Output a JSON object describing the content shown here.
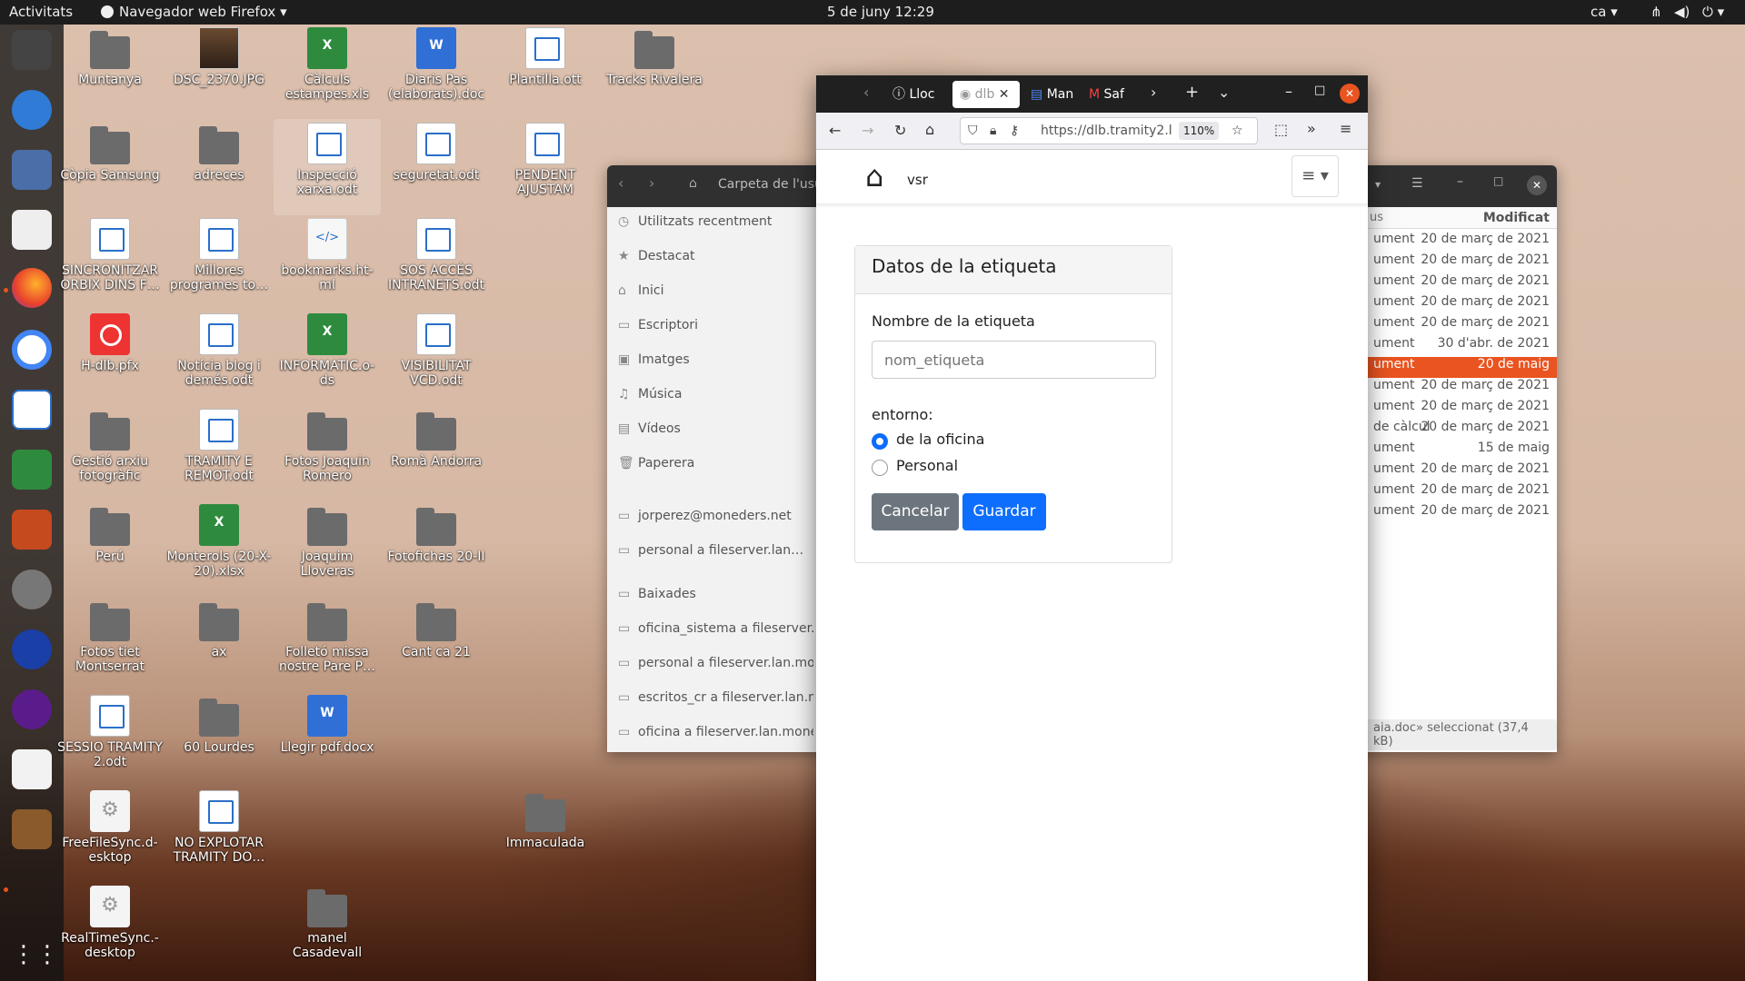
{
  "topbar": {
    "activities": "Activitats",
    "app": "Navegador web Firefox ▾",
    "clock": "5 de juny  12:29",
    "lang": "ca ▾"
  },
  "desktop": {
    "icons": [
      {
        "label": "Muntanya",
        "type": "folder"
      },
      {
        "label": "DSC_2370.JPG",
        "type": "photo"
      },
      {
        "label": "Càlculs estampes.xls",
        "type": "sheet"
      },
      {
        "label": "Diaris Pas (elaborats).doc",
        "type": "word"
      },
      {
        "label": "Plantilla.ott",
        "type": "doc"
      },
      {
        "label": "Tracks Rivalera",
        "type": "folder"
      },
      {
        "label": "Còpia Samsung",
        "type": "folder"
      },
      {
        "label": "adreces",
        "type": "folder"
      },
      {
        "label": "Inspecció xarxa.odt",
        "type": "doc"
      },
      {
        "label": "seguretat.odt",
        "type": "doc"
      },
      {
        "label": "PENDENT AJUSTAM",
        "type": "doc"
      },
      {
        "label": "SINCRONITZAR ORBIX DINS F…",
        "type": "doc"
      },
      {
        "label": "Millores programes to…",
        "type": "doc"
      },
      {
        "label": "bookmarks.ht-ml",
        "type": "code"
      },
      {
        "label": "SOS ACCÉS INTRANETS.odt",
        "type": "doc"
      },
      {
        "label": "H-dlb.pfx",
        "type": "red"
      },
      {
        "label": "Notícia blog i demés.odt",
        "type": "doc"
      },
      {
        "label": "INFORMATIC.o-ds",
        "type": "sheet"
      },
      {
        "label": "VISIBILITAT VCD.odt",
        "type": "doc"
      },
      {
        "label": "Gestió arxiu fotogràfic",
        "type": "folder"
      },
      {
        "label": "TRAMITY E REMOT.odt",
        "type": "doc"
      },
      {
        "label": "Fotos Joaquin Romero",
        "type": "folder"
      },
      {
        "label": "Romà Andorra",
        "type": "folder"
      },
      {
        "label": "Perú",
        "type": "folder"
      },
      {
        "label": "Monterols (20-X-20).xlsx",
        "type": "sheet"
      },
      {
        "label": "Joaquim Lloveras",
        "type": "folder"
      },
      {
        "label": "Fotofichas 20-II",
        "type": "folder"
      },
      {
        "label": "Fotos tiet Montserrat",
        "type": "folder"
      },
      {
        "label": "ax",
        "type": "folder"
      },
      {
        "label": "Folletó missa nostre Pare P…",
        "type": "folder"
      },
      {
        "label": "Cant ca 21",
        "type": "folder"
      },
      {
        "label": "SESSIO TRAMITY 2.odt",
        "type": "doc"
      },
      {
        "label": "60 Lourdes",
        "type": "folder"
      },
      {
        "label": "Llegir pdf.docx",
        "type": "word"
      },
      {
        "label": "FreeFileSync.d-esktop",
        "type": "gear"
      },
      {
        "label": "NO EXPLOTAR TRAMITY DO…",
        "type": "doc"
      },
      {
        "label": "Immaculada",
        "type": "folder"
      },
      {
        "label": "RealTimeSync.-desktop",
        "type": "gear"
      },
      {
        "label": "manel Casadevall",
        "type": "folder"
      }
    ]
  },
  "files": {
    "path": "Carpeta de l'usu",
    "sidebar": [
      "Utilitzats recentment",
      "Destacat",
      "Inici",
      "Escriptori",
      "Imatges",
      "Música",
      "Vídeos",
      "Paperera"
    ],
    "remote": [
      "jorperez@moneders.net",
      "personal a fileserver.lan…"
    ],
    "bookmarks": [
      "Baixades",
      "oficina_sistema a fileserver.l…",
      "personal a fileserver.lan.mo…",
      "escritos_cr a fileserver.lan.m…",
      "oficina a fileserver.lan.mone…"
    ],
    "col_modified": "Modificat",
    "rows": [
      {
        "type": "ument",
        "date": "20 de març de 2021"
      },
      {
        "type": "ument",
        "date": "20 de març de 2021"
      },
      {
        "type": "ument",
        "date": "20 de març de 2021"
      },
      {
        "type": "ument",
        "date": "20 de març de 2021"
      },
      {
        "type": "ument",
        "date": "20 de març de 2021"
      },
      {
        "type": "ument",
        "date": "30 d'abr. de 2021"
      },
      {
        "type": "ument",
        "date": "20 de maig"
      },
      {
        "type": "ument",
        "date": "20 de març de 2021"
      },
      {
        "type": "ument",
        "date": "20 de març de 2021"
      },
      {
        "type": "de càlcul",
        "date": "20 de març de 2021"
      },
      {
        "type": "ument",
        "date": "15 de maig"
      },
      {
        "type": "ument",
        "date": "20 de març de 2021"
      },
      {
        "type": "ument",
        "date": "20 de març de 2021"
      },
      {
        "type": "ument",
        "date": "20 de març de 2021"
      }
    ],
    "status": "aia.doc» seleccionat (37,4 kB)"
  },
  "firefox": {
    "tabs": [
      "Lloc",
      "dlb",
      "Man",
      "Saf"
    ],
    "url": "https://dlb.tramity2.l",
    "zoom": "110%",
    "site_brand": "vsr",
    "card": {
      "title": "Datos de la etiqueta",
      "name_label": "Nombre de la etiqueta",
      "name_placeholder": "nom_etiqueta",
      "env_label": "entorno:",
      "opt1": "de la oficina",
      "opt2": "Personal",
      "cancel": "Cancelar",
      "save": "Guardar"
    }
  },
  "colors": {
    "accent": "#e95420",
    "primary": "#0d6efd",
    "secondary": "#6c757d"
  }
}
